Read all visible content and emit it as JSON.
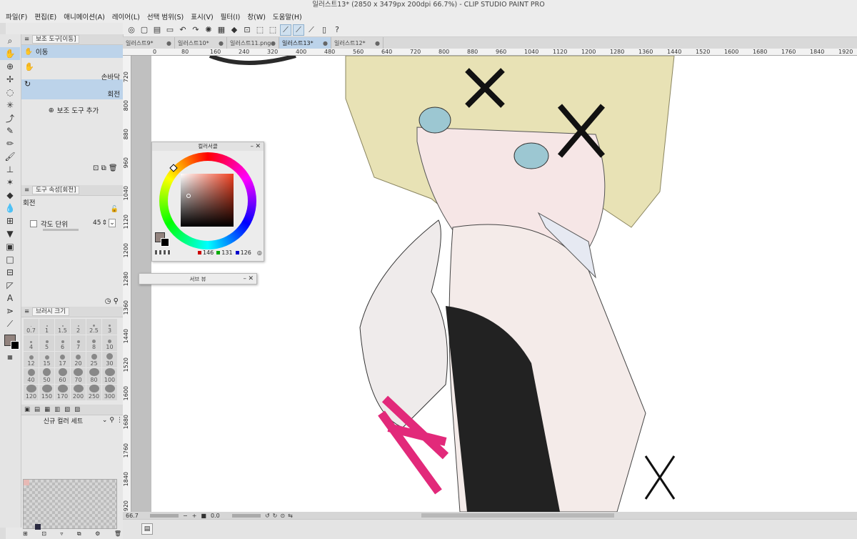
{
  "app": {
    "title": "일러스트13* (2850 x 3479px 200dpi 66.7%) - CLIP STUDIO PAINT PRO"
  },
  "menu": [
    "파일(F)",
    "편집(E)",
    "애니메이션(A)",
    "레이어(L)",
    "선택 범위(S)",
    "표시(V)",
    "필터(I)",
    "창(W)",
    "도움말(H)"
  ],
  "doc_tabs": [
    {
      "label": "일러스트9*",
      "active": false
    },
    {
      "label": "일러스트10*",
      "active": false
    },
    {
      "label": "일러스트11.png",
      "active": false
    },
    {
      "label": "일러스트13*",
      "active": true
    },
    {
      "label": "일러스트12*",
      "active": false
    }
  ],
  "ruler_top": [
    "0",
    "80",
    "160",
    "240",
    "320",
    "400",
    "480",
    "560",
    "640",
    "720",
    "800",
    "880",
    "960",
    "1040",
    "1120",
    "1200",
    "1280",
    "1360",
    "1440",
    "1520",
    "1600",
    "1680",
    "1760",
    "1840",
    "1920"
  ],
  "ruler_left": [
    "720",
    "800",
    "880",
    "960",
    "1040",
    "1120",
    "1200",
    "1280",
    "1360",
    "1440",
    "1520",
    "1600",
    "1680",
    "1760",
    "1840",
    "1920"
  ],
  "subtool_panel": {
    "tab": "보조 도구[이동]",
    "group": "이동",
    "items": [
      "손바닥",
      "회전"
    ],
    "add_label": "보조 도구 추가"
  },
  "tool_property": {
    "tab": "도구 속성[회전]",
    "name": "회전",
    "angle_label": "각도 단위",
    "angle_value": "45"
  },
  "brush_size": {
    "tab": "브러시 크기",
    "sizes": [
      "0.7",
      "1",
      "1.5",
      "2",
      "2.5",
      "3",
      "4",
      "5",
      "6",
      "7",
      "8",
      "10",
      "12",
      "15",
      "17",
      "20",
      "25",
      "30",
      "40",
      "50",
      "60",
      "70",
      "80",
      "100",
      "120",
      "150",
      "170",
      "200",
      "250",
      "300"
    ]
  },
  "color_set": {
    "name": "신규 컬러 세트"
  },
  "color_circle": {
    "title": "컬러서클",
    "r": "146",
    "g": "131",
    "b": "126",
    "current_color": "#92837e"
  },
  "navigator": {
    "title": "서브 뷰"
  },
  "status": {
    "zoom": "66.7",
    "rotation": "0.0"
  }
}
